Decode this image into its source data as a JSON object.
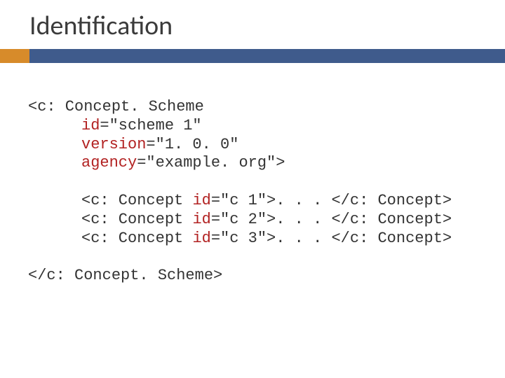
{
  "slide": {
    "title": "Identification"
  },
  "code": {
    "open_tag": "<c: Concept. Scheme",
    "attr1_name": "id",
    "attr1_val": "=\"scheme 1\"",
    "attr2_name": "version",
    "attr2_val": "=\"1. 0. 0\"",
    "attr3_name": "agency",
    "attr3_val": "=\"example. org\">",
    "line1_a": "<c: Concept ",
    "line1_b": "id",
    "line1_c": "=\"c 1\">. . . </c: Concept>",
    "line2_a": "<c: Concept ",
    "line2_b": "id",
    "line2_c": "=\"c 2\">. . . </c: Concept>",
    "line3_a": "<c: Concept ",
    "line3_b": "id",
    "line3_c": "=\"c 3\">. . . </c: Concept>",
    "close_tag": "</c: Concept. Scheme>"
  }
}
